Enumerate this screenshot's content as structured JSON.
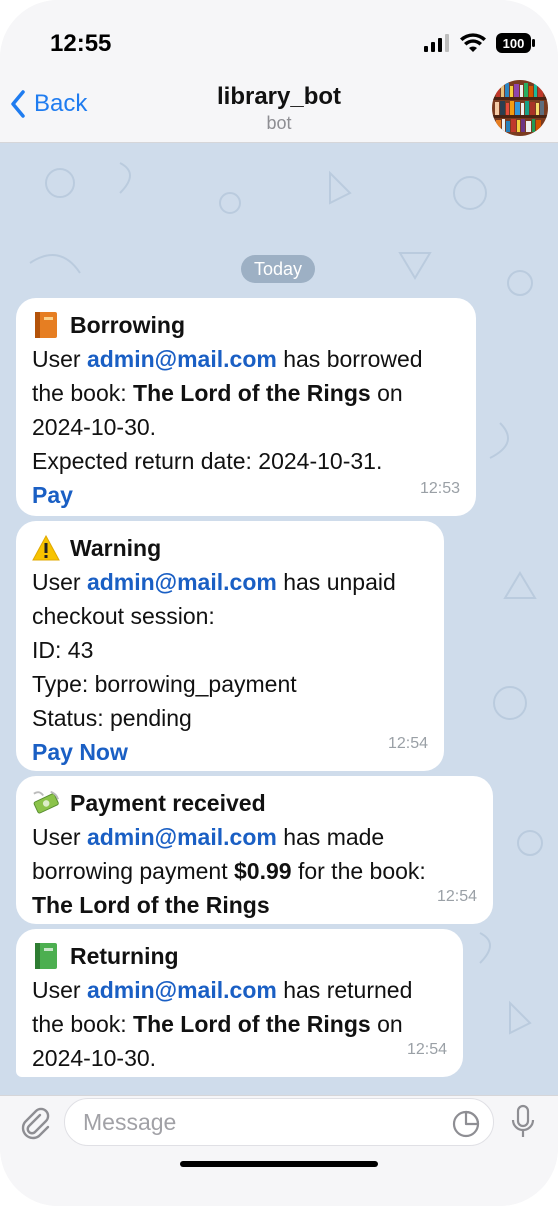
{
  "status_bar": {
    "time": "12:55",
    "battery": "100"
  },
  "nav": {
    "back_label": "Back",
    "title": "library_bot",
    "subtitle": "bot"
  },
  "chat": {
    "date_separator": "Today",
    "messages": [
      {
        "emoji": "orange-book",
        "title": "Borrowing",
        "line1_prefix": "User",
        "email": "admin@mail.com",
        "line1_suffix": " has borrowed",
        "line2_prefix": "the book:",
        "book": "The Lord of the Rings",
        "line2_suffix": " on",
        "line3": "2024-10-30.",
        "line4": "Expected return date: 2024-10-31.",
        "action": "Pay",
        "time": "12:53"
      },
      {
        "emoji": "warning",
        "title": "Warning",
        "line1_prefix": "User",
        "email": "admin@mail.com",
        "line1_suffix": " has unpaid",
        "line2": "checkout session:",
        "line3": "ID: 43",
        "line4": "Type: borrowing_payment",
        "line5": "Status: pending",
        "action": "Pay Now",
        "time": "12:54"
      },
      {
        "emoji": "money-with-wings",
        "title": "Payment received",
        "line1_prefix": "User",
        "email": "admin@mail.com",
        "line1_suffix": " has made",
        "line2_prefix": "borrowing payment",
        "amount": "$0.99",
        "line2_suffix": " for the book:",
        "book": "The Lord of the Rings",
        "time": "12:54"
      },
      {
        "emoji": "green-book",
        "title": "Returning",
        "line1_prefix": "User",
        "email": "admin@mail.com",
        "line1_suffix": " has returned",
        "line2_prefix": "the book:",
        "book": "The Lord of the Rings",
        "line2_suffix": " on",
        "line3": "2024-10-30.",
        "time": "12:54"
      }
    ]
  },
  "composer": {
    "placeholder": "Message"
  },
  "colors": {
    "accent": "#1f7cf0",
    "link": "#1a5fc4",
    "chat_bg": "#cfdceb"
  }
}
